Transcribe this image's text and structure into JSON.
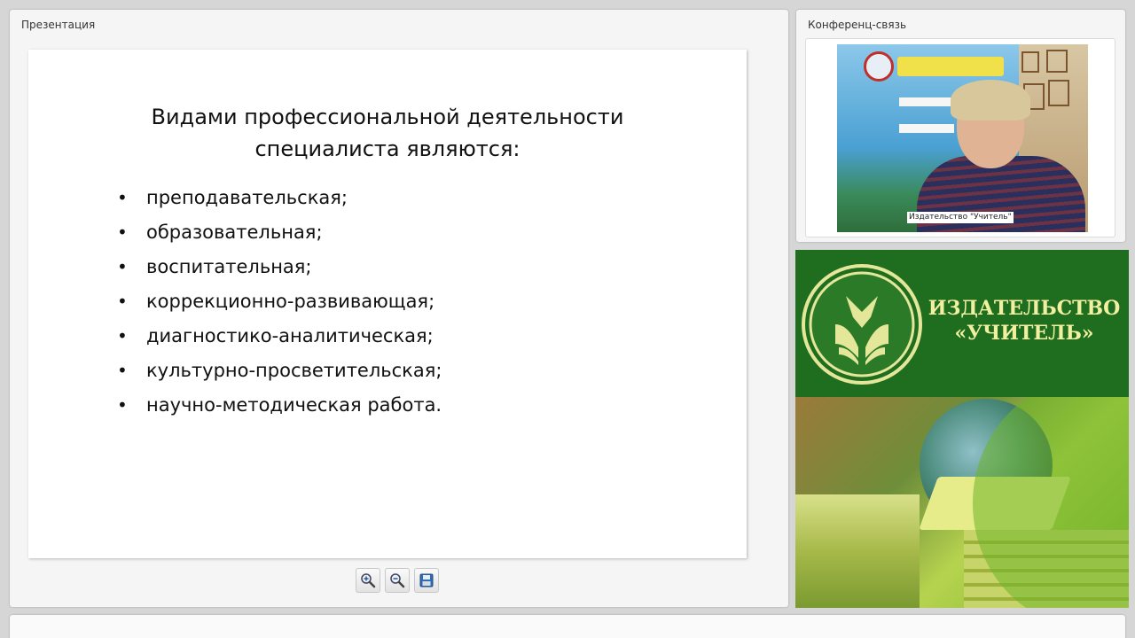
{
  "presentation_panel": {
    "title": "Презентация",
    "slide": {
      "title_lines": [
        "Видами профессиональной деятельности",
        "специалиста являются:"
      ],
      "items": [
        "преподавательская;",
        "образовательная;",
        "воспитательная;",
        "коррекционно-развивающая;",
        "диагностико-аналитическая;",
        "культурно-просветительская;",
        "научно-методическая работа."
      ]
    },
    "toolbar": {
      "zoom_in_icon": "zoom-in-icon",
      "zoom_out_icon": "zoom-out-icon",
      "save_icon": "save-icon"
    }
  },
  "conference_panel": {
    "title": "Конференц-связь",
    "participant_label": "Издательство \"Учитель\""
  },
  "ad_banner": {
    "name_lines": [
      "ИЗДАТЕЛЬСТВО",
      "«УЧИТЕЛЬ»"
    ],
    "colors": {
      "top_bg": "#1f6e1f",
      "text": "#f2efa0"
    }
  }
}
